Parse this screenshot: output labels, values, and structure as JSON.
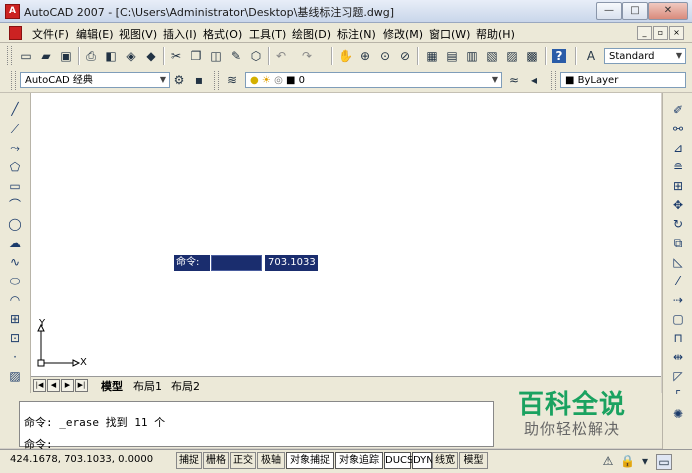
{
  "title": "AutoCAD 2007 - [C:\\Users\\Administrator\\Desktop\\基线标注习题.dwg]",
  "window_buttons": {
    "minimize": "—",
    "maximize": "□",
    "close": "✕"
  },
  "menu": [
    "文件(F)",
    "编辑(E)",
    "视图(V)",
    "插入(I)",
    "格式(O)",
    "工具(T)",
    "绘图(D)",
    "标注(N)",
    "修改(M)",
    "窗口(W)",
    "帮助(H)"
  ],
  "mdi_buttons": {
    "minimize": "_",
    "restore": "▫",
    "close": "×"
  },
  "toolbar1": {
    "icons": [
      "new-icon",
      "open-icon",
      "save-icon",
      "plot-icon",
      "plot-preview-icon",
      "publish-icon",
      "3d-dwf-icon",
      "cut-icon",
      "copy-icon",
      "paste-icon",
      "match-properties-icon",
      "block-editor-icon",
      "undo-icon",
      "redo-icon",
      "pan-icon",
      "zoom-realtime-icon",
      "zoom-window-icon",
      "zoom-previous-icon",
      "properties-icon",
      "design-center-icon",
      "tool-palettes-icon",
      "sheet-set-icon",
      "markup-icon",
      "calculator-icon",
      "help-icon"
    ],
    "text_style_icon": "text-style-icon",
    "text_style": "Standard"
  },
  "toolbar2": {
    "workspace": "AutoCAD 经典",
    "layer_name": "0",
    "color": "ByLayer"
  },
  "left_tools": [
    "line-icon",
    "construction-line-icon",
    "polyline-icon",
    "polygon-icon",
    "rectangle-icon",
    "arc-icon",
    "circle-icon",
    "revision-cloud-icon",
    "spline-icon",
    "ellipse-icon",
    "ellipse-arc-icon",
    "insert-block-icon",
    "make-block-icon",
    "point-icon",
    "hatch-icon"
  ],
  "right_tools": [
    "erase-icon",
    "copy-object-icon",
    "mirror-icon",
    "offset-icon",
    "array-icon",
    "move-icon",
    "rotate-icon",
    "scale-icon",
    "stretch-icon",
    "trim-icon",
    "extend-icon",
    "break-at-point-icon",
    "break-icon",
    "join-icon",
    "chamfer-icon",
    "fillet-icon",
    "explode-icon"
  ],
  "dynamic_input": {
    "label": "命令:",
    "value": "703.1033"
  },
  "ucs": {
    "x_label": "X",
    "y_label": "Y"
  },
  "tabs": [
    "模型",
    "布局1",
    "布局2"
  ],
  "command_lines": [
    "命令: _erase 找到 11 个",
    "命令:"
  ],
  "watermark": {
    "main": "百科全说",
    "sub": "助你轻松解决"
  },
  "status": {
    "coords": "424.1678, 703.1033, 0.0000",
    "buttons": [
      "捕捉",
      "栅格",
      "正交",
      "极轴",
      "对象捕捉",
      "对象追踪",
      "DUCS",
      "DYN",
      "线宽",
      "模型"
    ]
  },
  "colors": {
    "dyn_bg": "#1a2d6e",
    "watermark_green": "#1aa260"
  }
}
